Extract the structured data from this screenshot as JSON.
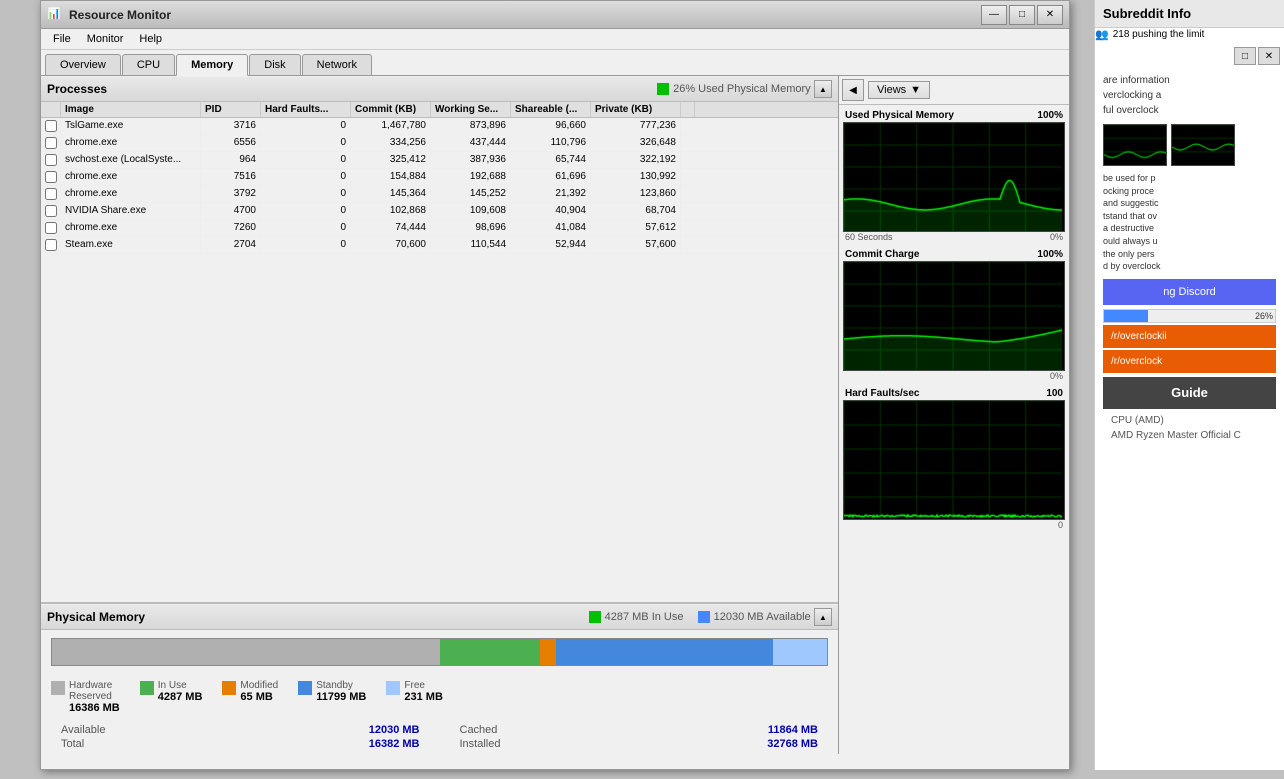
{
  "window": {
    "title": "Resource Monitor",
    "icon": "📊"
  },
  "titlebar": {
    "minimize": "—",
    "maximize": "□",
    "close": "✕"
  },
  "menu": {
    "items": [
      "File",
      "Monitor",
      "Help"
    ]
  },
  "tabs": [
    {
      "label": "Overview",
      "active": false
    },
    {
      "label": "CPU",
      "active": false
    },
    {
      "label": "Memory",
      "active": true
    },
    {
      "label": "Disk",
      "active": false
    },
    {
      "label": "Network",
      "active": false
    }
  ],
  "processes": {
    "section_title": "Processes",
    "badge_text": "26% Used Physical Memory",
    "columns": [
      "",
      "Image",
      "PID",
      "Hard Faults...",
      "Commit (KB)",
      "Working Se...",
      "Shareable (...",
      "Private (KB)"
    ],
    "rows": [
      {
        "image": "TslGame.exe",
        "pid": "3716",
        "hard_faults": "0",
        "commit": "1,467,780",
        "working_set": "873,896",
        "shareable": "96,660",
        "private": "777,236"
      },
      {
        "image": "chrome.exe",
        "pid": "6556",
        "hard_faults": "0",
        "commit": "334,256",
        "working_set": "437,444",
        "shareable": "110,796",
        "private": "326,648"
      },
      {
        "image": "svchost.exe (LocalSyste...",
        "pid": "964",
        "hard_faults": "0",
        "commit": "325,412",
        "working_set": "387,936",
        "shareable": "65,744",
        "private": "322,192"
      },
      {
        "image": "chrome.exe",
        "pid": "7516",
        "hard_faults": "0",
        "commit": "154,884",
        "working_set": "192,688",
        "shareable": "61,696",
        "private": "130,992"
      },
      {
        "image": "chrome.exe",
        "pid": "3792",
        "hard_faults": "0",
        "commit": "145,364",
        "working_set": "145,252",
        "shareable": "21,392",
        "private": "123,860"
      },
      {
        "image": "NVIDIA Share.exe",
        "pid": "4700",
        "hard_faults": "0",
        "commit": "102,868",
        "working_set": "109,608",
        "shareable": "40,904",
        "private": "68,704"
      },
      {
        "image": "chrome.exe",
        "pid": "7260",
        "hard_faults": "0",
        "commit": "74,444",
        "working_set": "98,696",
        "shareable": "41,084",
        "private": "57,612"
      },
      {
        "image": "Steam.exe",
        "pid": "2704",
        "hard_faults": "0",
        "commit": "70,600",
        "working_set": "110,544",
        "shareable": "52,944",
        "private": "57,600"
      }
    ]
  },
  "physical_memory": {
    "section_title": "Physical Memory",
    "in_use_label": "4287 MB In Use",
    "available_label": "12030 MB Available",
    "bar": {
      "hardware_pct": 50,
      "in_use_pct": 13,
      "modified_pct": 2,
      "standby_pct": 28,
      "free_pct": 7
    },
    "legend": [
      {
        "label": "Hardware\nReserved",
        "value": "16386 MB",
        "color": "#b0b0b0"
      },
      {
        "label": "In Use",
        "value": "4287 MB",
        "color": "#4caf50"
      },
      {
        "label": "Modified",
        "value": "65 MB",
        "color": "#e67e00"
      },
      {
        "label": "Standby",
        "value": "11799 MB",
        "color": "#4488dd"
      },
      {
        "label": "Free",
        "value": "231 MB",
        "color": "#9ec8ff"
      }
    ],
    "stats": [
      {
        "label": "Available",
        "value": "12030 MB"
      },
      {
        "label": "Cached",
        "value": "11864 MB"
      },
      {
        "label": "Total",
        "value": "16382 MB"
      },
      {
        "label": "Installed",
        "value": "32768 MB"
      }
    ]
  },
  "charts": {
    "views_label": "Views",
    "used_physical": {
      "title": "Used Physical Memory",
      "max": "100%",
      "min": "0%",
      "time_label": "60 Seconds"
    },
    "commit_charge": {
      "title": "Commit Charge",
      "max": "100%",
      "min": "0%"
    },
    "hard_faults": {
      "title": "Hard Faults/sec",
      "max": "100",
      "min": "0"
    }
  },
  "sidebar": {
    "title": "Subreddit Info",
    "push_text": "218 pushing the limit",
    "body_text": "are information\nverclocking a\nful overclock",
    "body2": "be used for p\nocking proce\nand suggestic\ntstand that ov\na destructive\nould always u\nthe only pers\nd by overcloci",
    "discord_label": "ng Discord",
    "oc_link1": "/r/overclockii",
    "oc_link2": "/r/overclock",
    "guide_label": "Guide",
    "footer1": "CPU (AMD)",
    "footer2": "AMD Ryzen Master Official C"
  }
}
